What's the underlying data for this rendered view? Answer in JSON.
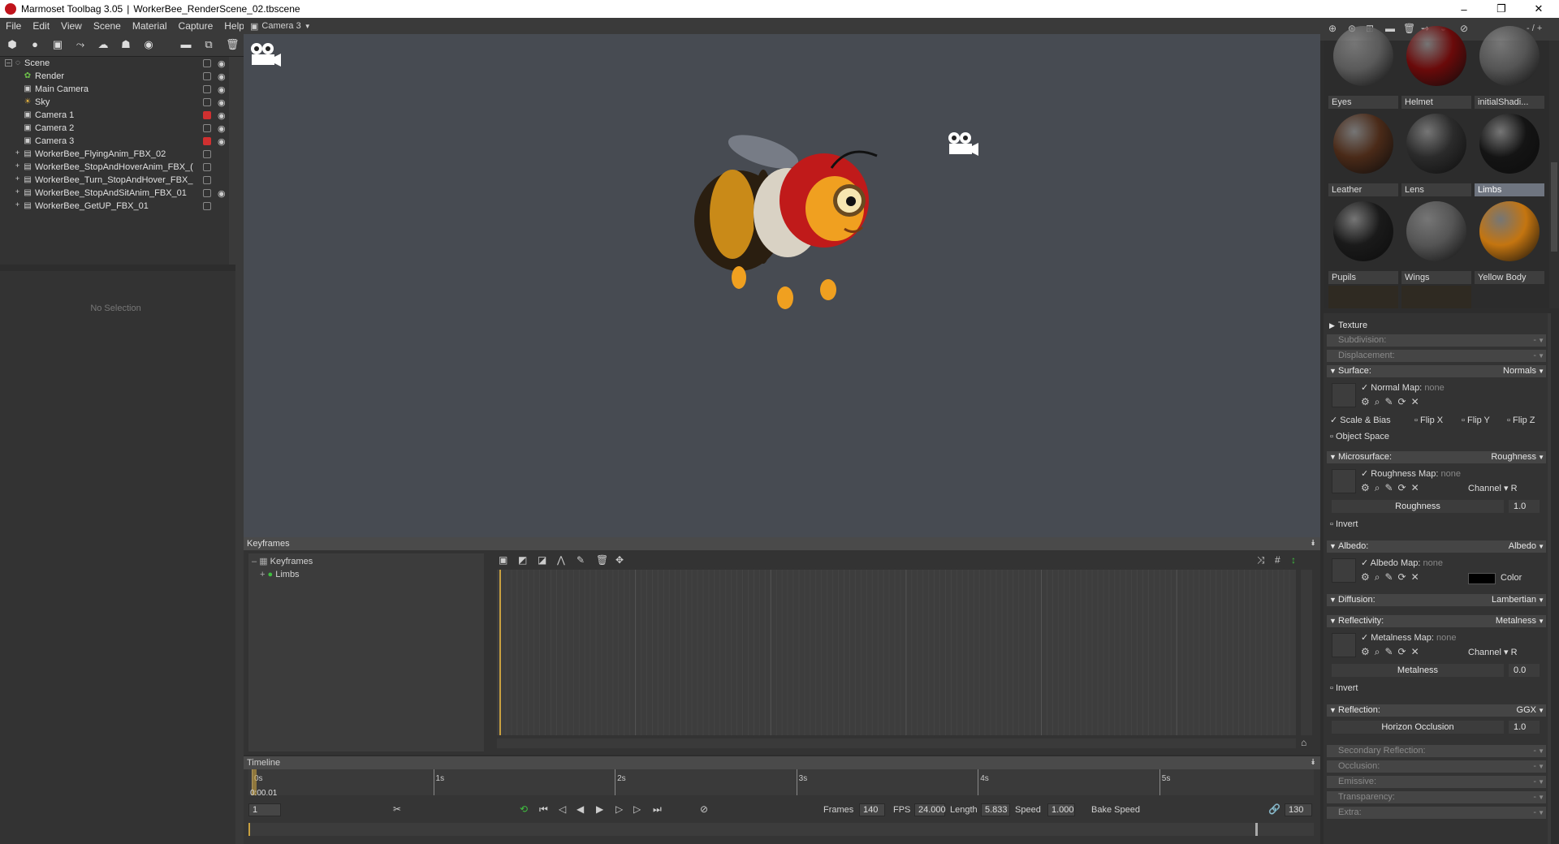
{
  "window": {
    "app": "Marmoset Toolbag 3.05",
    "separator": "|",
    "file": "WorkerBee_RenderScene_02.tbscene",
    "controls": [
      "–",
      "❐",
      "✕"
    ]
  },
  "menu": [
    "File",
    "Edit",
    "View",
    "Scene",
    "Material",
    "Capture",
    "Help"
  ],
  "camera_tab": {
    "label": "Camera 3"
  },
  "scene_tree": [
    {
      "label": "Scene",
      "icon": "scene-icon",
      "expanded": true,
      "locked": false,
      "visible": true
    },
    {
      "label": "Render",
      "icon": "render-icon",
      "locked": false,
      "visible": true
    },
    {
      "label": "Main Camera",
      "icon": "camera-icon",
      "locked": false,
      "visible": true
    },
    {
      "label": "Sky",
      "icon": "sky-icon",
      "locked": false,
      "visible": true
    },
    {
      "label": "Camera 1",
      "icon": "camera-icon",
      "locked": true,
      "visible": true
    },
    {
      "label": "Camera 2",
      "icon": "camera-icon",
      "locked": false,
      "visible": true
    },
    {
      "label": "Camera 3",
      "icon": "camera-icon",
      "locked": true,
      "visible": true
    },
    {
      "label": "WorkerBee_FlyingAnim_FBX_02",
      "icon": "fbx-icon",
      "locked": false,
      "visible": false
    },
    {
      "label": "WorkerBee_StopAndHoverAnim_FBX_(",
      "icon": "fbx-icon",
      "locked": false,
      "visible": false
    },
    {
      "label": "WorkerBee_Turn_StopAndHover_FBX_",
      "icon": "fbx-icon",
      "locked": false,
      "visible": false
    },
    {
      "label": "WorkerBee_StopAndSitAnim_FBX_01",
      "icon": "fbx-icon",
      "locked": false,
      "visible": true
    },
    {
      "label": "WorkerBee_GetUP_FBX_01",
      "icon": "fbx-icon",
      "locked": false,
      "visible": false
    }
  ],
  "properties": {
    "empty_text": "No Selection"
  },
  "keyframes": {
    "header": "Keyframes",
    "tree": [
      {
        "label": "Keyframes",
        "icon": "keyframes-icon"
      },
      {
        "label": "Limbs",
        "icon": "green-dot-icon"
      }
    ]
  },
  "timeline": {
    "header": "Timeline",
    "ticks": [
      "0s",
      "1s",
      "2s",
      "3s",
      "4s",
      "5s"
    ],
    "current_time": "0:00.01",
    "frame": "1",
    "frames_label": "Frames",
    "frames": "140",
    "fps_label": "FPS",
    "fps": "24.000",
    "length_label": "Length",
    "length": "5.833",
    "speed_label": "Speed",
    "speed": "1.000",
    "bake_speed": "Bake Speed",
    "end_frame": "130"
  },
  "materials": {
    "slot_indicator": "- / +",
    "items": [
      {
        "name": "Eyes",
        "color": "#5a5a5a"
      },
      {
        "name": "Helmet",
        "color": "#6a0a0a"
      },
      {
        "name": "initialShadi...",
        "color": "#555"
      },
      {
        "name": "Leather",
        "color": "#4a2a18"
      },
      {
        "name": "Lens",
        "color": "#2b2b2b"
      },
      {
        "name": "Limbs",
        "color": "#141414",
        "selected": true
      },
      {
        "name": "Pupils",
        "color": "#1a1a1a"
      },
      {
        "name": "Wings",
        "color": "#555"
      },
      {
        "name": "Yellow Body",
        "color": "#c47510"
      }
    ]
  },
  "material_panel": {
    "texture": "Texture",
    "subdivision": {
      "label": "Subdivision:",
      "value": "-"
    },
    "displacement": {
      "label": "Displacement:",
      "value": "-"
    },
    "surface": {
      "label": "Surface:",
      "value": "Normals"
    },
    "normal_map": {
      "label": "Normal Map:",
      "value": "none"
    },
    "scale_bias": "Scale & Bias",
    "flip_x": "Flip X",
    "flip_y": "Flip Y",
    "flip_z": "Flip Z",
    "object_space": "Object Space",
    "microsurface": {
      "label": "Microsurface:",
      "value": "Roughness"
    },
    "roughness_map": {
      "label": "Roughness Map:",
      "value": "none"
    },
    "channel_label": "Channel",
    "channel_value": "R",
    "roughness": {
      "label": "Roughness",
      "value": "1.0"
    },
    "invert": "Invert",
    "albedo": {
      "label": "Albedo:",
      "value": "Albedo"
    },
    "albedo_map": {
      "label": "Albedo Map:",
      "value": "none"
    },
    "color_label": "Color",
    "color_swatch": "#000000",
    "diffusion": {
      "label": "Diffusion:",
      "value": "Lambertian"
    },
    "reflectivity": {
      "label": "Reflectivity:",
      "value": "Metalness"
    },
    "metalness_map": {
      "label": "Metalness Map:",
      "value": "none"
    },
    "metalness": {
      "label": "Metalness",
      "value": "0.0"
    },
    "reflection": {
      "label": "Reflection:",
      "value": "GGX"
    },
    "horizon_occlusion": {
      "label": "Horizon Occlusion",
      "value": "1.0"
    },
    "secondary_reflection": {
      "label": "Secondary Reflection:",
      "value": "-"
    },
    "occlusion": {
      "label": "Occlusion:",
      "value": "-"
    },
    "emissive": {
      "label": "Emissive:",
      "value": "-"
    },
    "transparency": {
      "label": "Transparency:",
      "value": "-"
    },
    "extra": {
      "label": "Extra:",
      "value": "-"
    }
  },
  "colors": {
    "accent_timeline": "#c8a040",
    "viewport_bg": "#474b52",
    "lock_red": "#d03030"
  }
}
